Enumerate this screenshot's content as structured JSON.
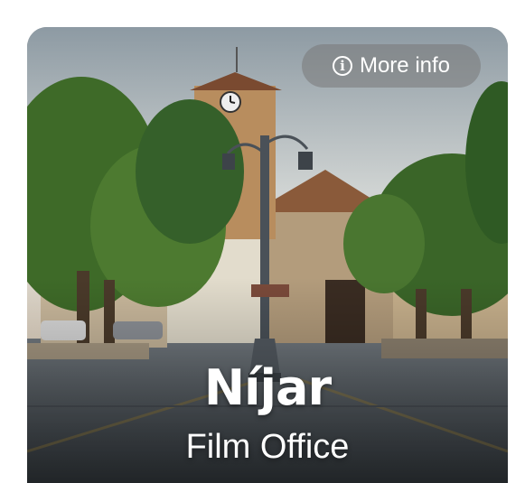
{
  "card": {
    "button_label": "More info",
    "button_icon": "info-icon",
    "title": "Níjar",
    "subtitle": "Film Office"
  },
  "colors": {
    "sky": "#c9cfd3",
    "foliage": "#3f6b2a",
    "stone": "#a07c58",
    "pavement": "#555c62",
    "text": "#ffffff"
  }
}
